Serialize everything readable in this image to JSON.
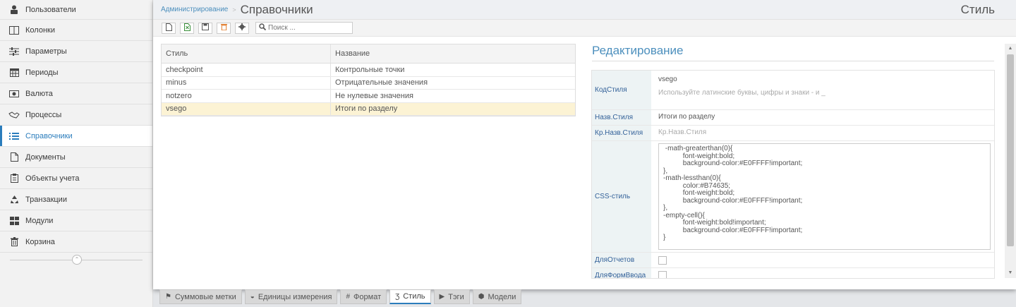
{
  "sidebar": {
    "items": [
      {
        "label": "Пользователи",
        "icon": "user-lock-icon"
      },
      {
        "label": "Колонки",
        "icon": "columns-icon"
      },
      {
        "label": "Параметры",
        "icon": "sliders-icon"
      },
      {
        "label": "Периоды",
        "icon": "calendar-icon"
      },
      {
        "label": "Валюта",
        "icon": "money-icon"
      },
      {
        "label": "Процессы",
        "icon": "handshake-icon"
      },
      {
        "label": "Справочники",
        "icon": "list-icon"
      },
      {
        "label": "Документы",
        "icon": "file-icon"
      },
      {
        "label": "Объекты учета",
        "icon": "clipboard-icon"
      },
      {
        "label": "Транзакции",
        "icon": "recycle-icon"
      },
      {
        "label": "Модули",
        "icon": "grid-icon"
      },
      {
        "label": "Корзина",
        "icon": "trash-icon"
      }
    ],
    "active_index": 6
  },
  "header": {
    "breadcrumb_parent": "Администрирование",
    "breadcrumb_current": "Справочники",
    "right_title": "Стиль"
  },
  "toolbar": {
    "search_placeholder": "Поиск ..."
  },
  "grid": {
    "columns": [
      "Стиль",
      "Название"
    ],
    "rows": [
      [
        "checkpoint",
        "Контрольные точки"
      ],
      [
        "minus",
        "Отрицательные значения"
      ],
      [
        "notzero",
        "Не нулевые значения"
      ],
      [
        "vsego",
        "Итоги по разделу"
      ]
    ],
    "selected_index": 3
  },
  "edit": {
    "title": "Редактирование",
    "code_label": "КодСтиля",
    "code_value": "vsego",
    "code_hint": "Используйте латинские буквы, цифры и знаки - и _",
    "name_label": "Назв.Стиля",
    "name_value": "Итоги по разделу",
    "short_label": "Кр.Назв.Стиля",
    "short_placeholder": "Кр.Назв.Стиля",
    "css_label": "CSS-стиль",
    "css_value": " -math-greaterthan(0){\n          font-weight:bold;\n          background-color:#E0FFFF!important;\n},\n-math-lessthan(0){\n          color:#B74635;\n          font-weight:bold;\n          background-color:#E0FFFF!important;\n},\n-empty-cell(){\n          font-weight:bold!important;\n          background-color:#E0FFFF!important;\n}",
    "reports_label": "ДляОтчетов",
    "forms_label": "ДляФормВвода"
  },
  "tabs": [
    {
      "label": "Суммовые метки",
      "icon": "pushpin-icon"
    },
    {
      "label": "Единицы измерения",
      "icon": "tachometer-icon"
    },
    {
      "label": "Формат",
      "icon": "hash-icon"
    },
    {
      "label": "Стиль",
      "icon": "css3-icon"
    },
    {
      "label": "Тэги",
      "icon": "tag-icon"
    },
    {
      "label": "Модели",
      "icon": "cubes-icon"
    }
  ],
  "active_tab": 3,
  "colors": {
    "accent": "#2b7dbc",
    "selected_row": "#fcf3d4",
    "title": "#4c8fbd"
  }
}
